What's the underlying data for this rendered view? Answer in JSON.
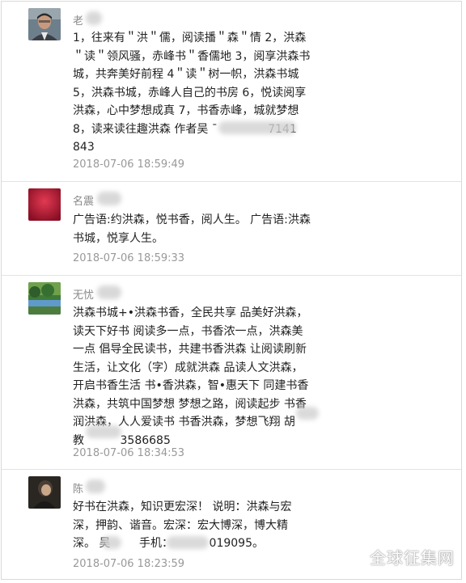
{
  "comments": [
    {
      "name": "老",
      "text": "1，往来有＂洪＂儒，阅读播＂森＂情 2，洪森\n＂读＂领风骚，赤峰书＂香儒地 3，阅享洪森书\n城，共奔美好前程 4＂读＂树一帜，洪森书城\n5，洪森书城，赤峰人自己的书房 6，悦读阅享\n洪森，心中梦想成真 7，书香赤峰，城就梦想\n8，读来读往趣洪森 作者吴 ¯              7141\n843",
      "time": "2018-07-06 18:59:49"
    },
    {
      "name": "名震",
      "text": "广告语:约洪森，悦书香，阅人生。 广告语:洪森\n书城，悦享人生。",
      "time": "2018-07-06 18:59:33"
    },
    {
      "name": "无忧",
      "text": "洪森书城+•洪森书香，全民共享 品美好洪森，\n读天下好书 阅读多一点，书香浓一点，洪森美\n一点 倡导全民读书，共建书香洪森 让阅读刷新\n生活，让文化（字）成就洪森 品读人文洪森，\n开启书香生活 书•香洪森，智•惠天下 同建书香\n洪森，共筑中国梦想 梦想之路，阅读起步 书香\n润洪森，人人爱读书 书香洪森，梦想飞翔 胡\n教          3586685",
      "time": "2018-07-06 18:34:53"
    },
    {
      "name": "陈",
      "text": "好书在洪森，知识更宏深！ 说明：洪森与宏\n深，押韵、谐音。宏深：宏大博深，博大精\n深。 吴        手机：          019095。",
      "time": "2018-07-06 18:23:59"
    }
  ],
  "watermark": "全球征集网"
}
